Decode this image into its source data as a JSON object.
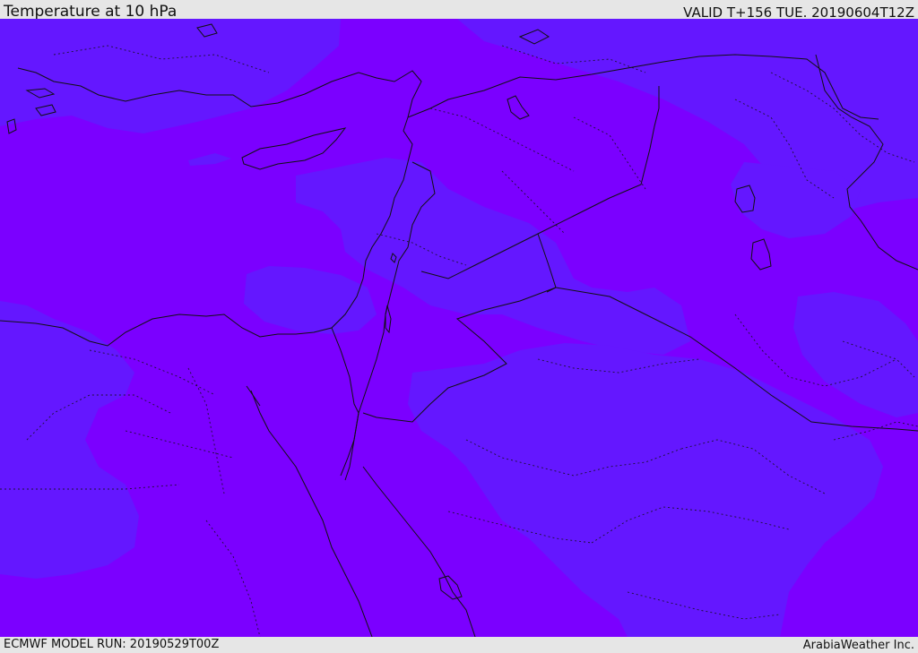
{
  "header": {
    "title": "Temperature at 10 hPa",
    "valid_time": "VALID T+156 TUE. 20190604T12Z"
  },
  "footer": {
    "model_run": "ECMWF MODEL RUN: 20190529T00Z",
    "credit": "ArabiaWeather Inc."
  },
  "colors": {
    "warm_band": "#7b00ff",
    "cool_band": "#6417ff",
    "border": "#111111",
    "frame": "#e6e6e6"
  },
  "map": {
    "parameter": "Temperature",
    "level_hpa": 10,
    "region": "Eastern Mediterranean and Middle East"
  }
}
